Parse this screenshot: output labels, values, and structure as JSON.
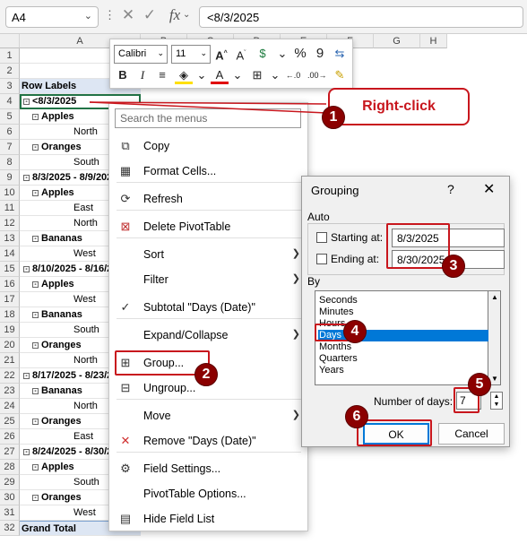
{
  "formula_bar": {
    "name_box": "A4",
    "formula": "<8/3/2025"
  },
  "columns": [
    "A",
    "B",
    "C",
    "D",
    "E",
    "F",
    "G",
    "H"
  ],
  "rows": [
    {
      "num": "1",
      "label": "",
      "style": ""
    },
    {
      "num": "2",
      "label": "",
      "style": ""
    },
    {
      "num": "3",
      "label": "Row Labels",
      "style": "hdr"
    },
    {
      "num": "4",
      "label": "<8/3/2025",
      "style": "bold sel",
      "box": "-"
    },
    {
      "num": "5",
      "label": "Apples",
      "style": "bold",
      "box": "-",
      "indent": 1
    },
    {
      "num": "6",
      "label": "North",
      "style": "",
      "indent": 2
    },
    {
      "num": "7",
      "label": "Oranges",
      "style": "bold",
      "box": "-",
      "indent": 1
    },
    {
      "num": "8",
      "label": "South",
      "style": "",
      "indent": 2
    },
    {
      "num": "9",
      "label": "8/3/2025 - 8/9/2025",
      "style": "bold",
      "box": "-"
    },
    {
      "num": "10",
      "label": "Apples",
      "style": "bold",
      "box": "-",
      "indent": 1
    },
    {
      "num": "11",
      "label": "East",
      "style": "",
      "indent": 2
    },
    {
      "num": "12",
      "label": "North",
      "style": "",
      "indent": 2
    },
    {
      "num": "13",
      "label": "Bananas",
      "style": "bold",
      "box": "-",
      "indent": 1
    },
    {
      "num": "14",
      "label": "West",
      "style": "",
      "indent": 2
    },
    {
      "num": "15",
      "label": "8/10/2025 - 8/16/2025",
      "style": "bold",
      "box": "-"
    },
    {
      "num": "16",
      "label": "Apples",
      "style": "bold",
      "box": "-",
      "indent": 1
    },
    {
      "num": "17",
      "label": "West",
      "style": "",
      "indent": 2
    },
    {
      "num": "18",
      "label": "Bananas",
      "style": "bold",
      "box": "-",
      "indent": 1
    },
    {
      "num": "19",
      "label": "South",
      "style": "",
      "indent": 2
    },
    {
      "num": "20",
      "label": "Oranges",
      "style": "bold",
      "box": "-",
      "indent": 1
    },
    {
      "num": "21",
      "label": "North",
      "style": "",
      "indent": 2
    },
    {
      "num": "22",
      "label": "8/17/2025 - 8/23/2025",
      "style": "bold",
      "box": "-"
    },
    {
      "num": "23",
      "label": "Bananas",
      "style": "bold",
      "box": "-",
      "indent": 1
    },
    {
      "num": "24",
      "label": "North",
      "style": "",
      "indent": 2
    },
    {
      "num": "25",
      "label": "Oranges",
      "style": "bold",
      "box": "-",
      "indent": 1
    },
    {
      "num": "26",
      "label": "East",
      "style": "",
      "indent": 2
    },
    {
      "num": "27",
      "label": "8/24/2025 - 8/30/2025",
      "style": "bold",
      "box": "-"
    },
    {
      "num": "28",
      "label": "Apples",
      "style": "bold",
      "box": "-",
      "indent": 1
    },
    {
      "num": "29",
      "label": "South",
      "style": "",
      "indent": 2
    },
    {
      "num": "30",
      "label": "Oranges",
      "style": "bold",
      "box": "-",
      "indent": 1
    },
    {
      "num": "31",
      "label": "West",
      "style": "",
      "indent": 2
    },
    {
      "num": "32",
      "label": "Grand Total",
      "style": "total"
    }
  ],
  "mini_toolbar": {
    "font": "Calibri",
    "size": "11"
  },
  "context_menu": {
    "search_placeholder": "Search the menus",
    "items": [
      {
        "label": "Copy",
        "icon": "copy-icon",
        "glyph": "⧉"
      },
      {
        "label": "Format Cells...",
        "icon": "format-cells-icon",
        "glyph": "▦"
      },
      {
        "label": "Refresh",
        "icon": "refresh-icon",
        "glyph": "⟳"
      },
      {
        "label": "Delete PivotTable",
        "icon": "delete-pivot-icon",
        "glyph": "⊠"
      },
      {
        "label": "Sort",
        "icon": "",
        "glyph": "",
        "arrow": true
      },
      {
        "label": "Filter",
        "icon": "",
        "glyph": "",
        "arrow": true
      },
      {
        "label": "Subtotal \"Days (Date)\"",
        "icon": "check-icon",
        "glyph": "✓"
      },
      {
        "label": "Expand/Collapse",
        "icon": "",
        "glyph": "",
        "arrow": true
      },
      {
        "label": "Group...",
        "icon": "group-icon",
        "glyph": "⊞"
      },
      {
        "label": "Ungroup...",
        "icon": "ungroup-icon",
        "glyph": "⊟"
      },
      {
        "label": "Move",
        "icon": "",
        "glyph": "",
        "arrow": true
      },
      {
        "label": "Remove \"Days (Date)\"",
        "icon": "remove-icon",
        "glyph": "✕"
      },
      {
        "label": "Field Settings...",
        "icon": "field-settings-icon",
        "glyph": "⚙"
      },
      {
        "label": "PivotTable Options...",
        "icon": "",
        "glyph": ""
      },
      {
        "label": "Hide Field List",
        "icon": "field-list-icon",
        "glyph": "▤"
      }
    ]
  },
  "grouping_dialog": {
    "title": "Grouping",
    "help": "?",
    "auto_label": "Auto",
    "starting_label": "Starting at:",
    "starting_value": "8/3/2025",
    "ending_label": "Ending at:",
    "ending_value": "8/30/2025",
    "by_label": "By",
    "by_options": [
      "Seconds",
      "Minutes",
      "Hours",
      "Days",
      "Months",
      "Quarters",
      "Years"
    ],
    "selected": "Days",
    "days_label": "Number of days:",
    "days_value": "7",
    "ok": "OK",
    "cancel": "Cancel"
  },
  "annotations": {
    "callout": "Right-click",
    "steps": [
      "1",
      "2",
      "3",
      "4",
      "5",
      "6"
    ]
  },
  "colors": {
    "annotation_red": "#c8161d",
    "badge": "#8b0000",
    "selection_blue": "#0078d7"
  }
}
